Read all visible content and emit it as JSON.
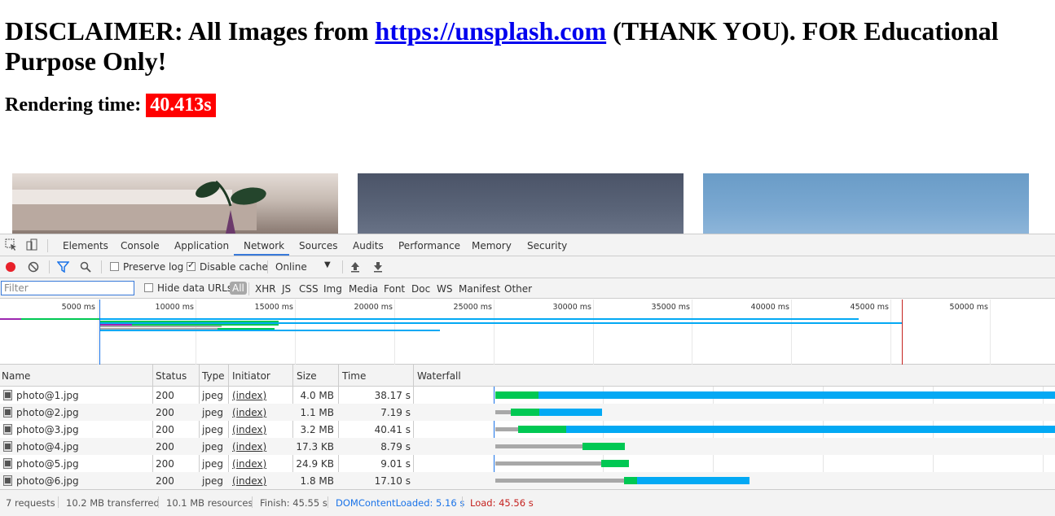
{
  "page": {
    "disclaimer_prefix": "DISCLAIMER: All Images from ",
    "disclaimer_link": "https://unsplash.com",
    "disclaimer_suffix": " (THANK YOU). FOR Educational Purpose Only!",
    "rendering_label": "Rendering time: ",
    "rendering_value": "40.413s"
  },
  "devtools": {
    "tabs": [
      "Elements",
      "Console",
      "Application",
      "Network",
      "Sources",
      "Audits",
      "Performance",
      "Memory",
      "Security"
    ],
    "active_tab": "Network",
    "toolbar": {
      "preserve_log": "Preserve log",
      "preserve_log_checked": false,
      "disable_cache": "Disable cache",
      "disable_cache_checked": true,
      "throttle": "Online"
    },
    "filter": {
      "placeholder": "Filter",
      "hide_data_urls": "Hide data URLs",
      "types": [
        "All",
        "XHR",
        "JS",
        "CSS",
        "Img",
        "Media",
        "Font",
        "Doc",
        "WS",
        "Manifest",
        "Other"
      ]
    },
    "overview": {
      "ticks": [
        "5000 ms",
        "10000 ms",
        "15000 ms",
        "20000 ms",
        "25000 ms",
        "30000 ms",
        "35000 ms",
        "40000 ms",
        "45000 ms",
        "50000 ms"
      ]
    },
    "columns": [
      "Name",
      "Status",
      "Type",
      "Initiator",
      "Size",
      "Time",
      "Waterfall"
    ],
    "requests": [
      {
        "name": "photo@1.jpg",
        "status": "200",
        "type": "jpeg",
        "initiator": "(index)",
        "size": "4.0 MB",
        "time": "38.17 s"
      },
      {
        "name": "photo@2.jpg",
        "status": "200",
        "type": "jpeg",
        "initiator": "(index)",
        "size": "1.1 MB",
        "time": "7.19 s"
      },
      {
        "name": "photo@3.jpg",
        "status": "200",
        "type": "jpeg",
        "initiator": "(index)",
        "size": "3.2 MB",
        "time": "40.41 s"
      },
      {
        "name": "photo@4.jpg",
        "status": "200",
        "type": "jpeg",
        "initiator": "(index)",
        "size": "17.3 KB",
        "time": "8.79 s"
      },
      {
        "name": "photo@5.jpg",
        "status": "200",
        "type": "jpeg",
        "initiator": "(index)",
        "size": "24.9 KB",
        "time": "9.01 s"
      },
      {
        "name": "photo@6.jpg",
        "status": "200",
        "type": "jpeg",
        "initiator": "(index)",
        "size": "1.8 MB",
        "time": "17.10 s"
      }
    ],
    "status": {
      "requests": "7 requests",
      "transferred": "10.2 MB transferred",
      "resources": "10.1 MB resources",
      "finish": "Finish: 45.55 s",
      "dom_content_loaded": "DOMContentLoaded: 5.16 s",
      "load": "Load: 45.56 s"
    },
    "colors": {
      "accent": "#3879d9",
      "waiting": "#a8a8a8",
      "ttfb": "#00c853",
      "download": "#03a9f4",
      "dcl": "#1a73e8",
      "load": "#c5221f",
      "rendering_bg": "#ff0000"
    }
  }
}
